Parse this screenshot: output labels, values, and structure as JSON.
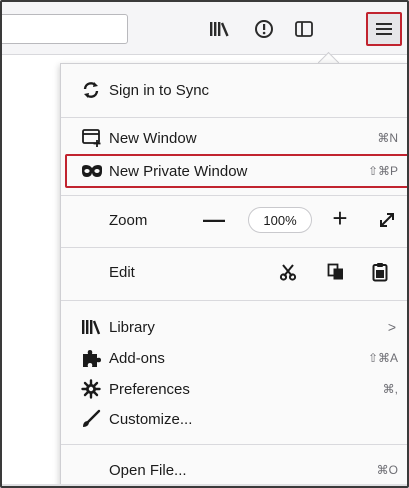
{
  "toolbar": {
    "icons": [
      "library-icon",
      "reader-icon",
      "sidebar-icon",
      "hamburger-menu-icon"
    ]
  },
  "menu": {
    "sync": {
      "label": "Sign in to Sync",
      "icon": "sync-icon"
    },
    "new_window": {
      "label": "New Window",
      "shortcut": "⌘N",
      "icon": "new-window-icon"
    },
    "new_private_window": {
      "label": "New Private Window",
      "shortcut": "⇧⌘P",
      "icon": "private-mask-icon"
    },
    "zoom": {
      "label": "Zoom",
      "value": "100%",
      "minus": "—",
      "plus": "+"
    },
    "edit": {
      "label": "Edit",
      "icons": [
        "cut-icon",
        "copy-icon",
        "paste-icon"
      ]
    },
    "library": {
      "label": "Library",
      "shortcut": ">",
      "icon": "library-icon"
    },
    "addons": {
      "label": "Add-ons",
      "shortcut": "⇧⌘A",
      "icon": "puzzle-icon"
    },
    "preferences": {
      "label": "Preferences",
      "shortcut": "⌘,",
      "icon": "gear-icon"
    },
    "customize": {
      "label": "Customize...",
      "icon": "paintbrush-icon"
    },
    "open_file": {
      "label": "Open File...",
      "shortcut": "⌘O"
    }
  },
  "colors": {
    "highlight": "#c1232f",
    "panel": "#fafafa",
    "toolbar": "#f5f5f7"
  }
}
